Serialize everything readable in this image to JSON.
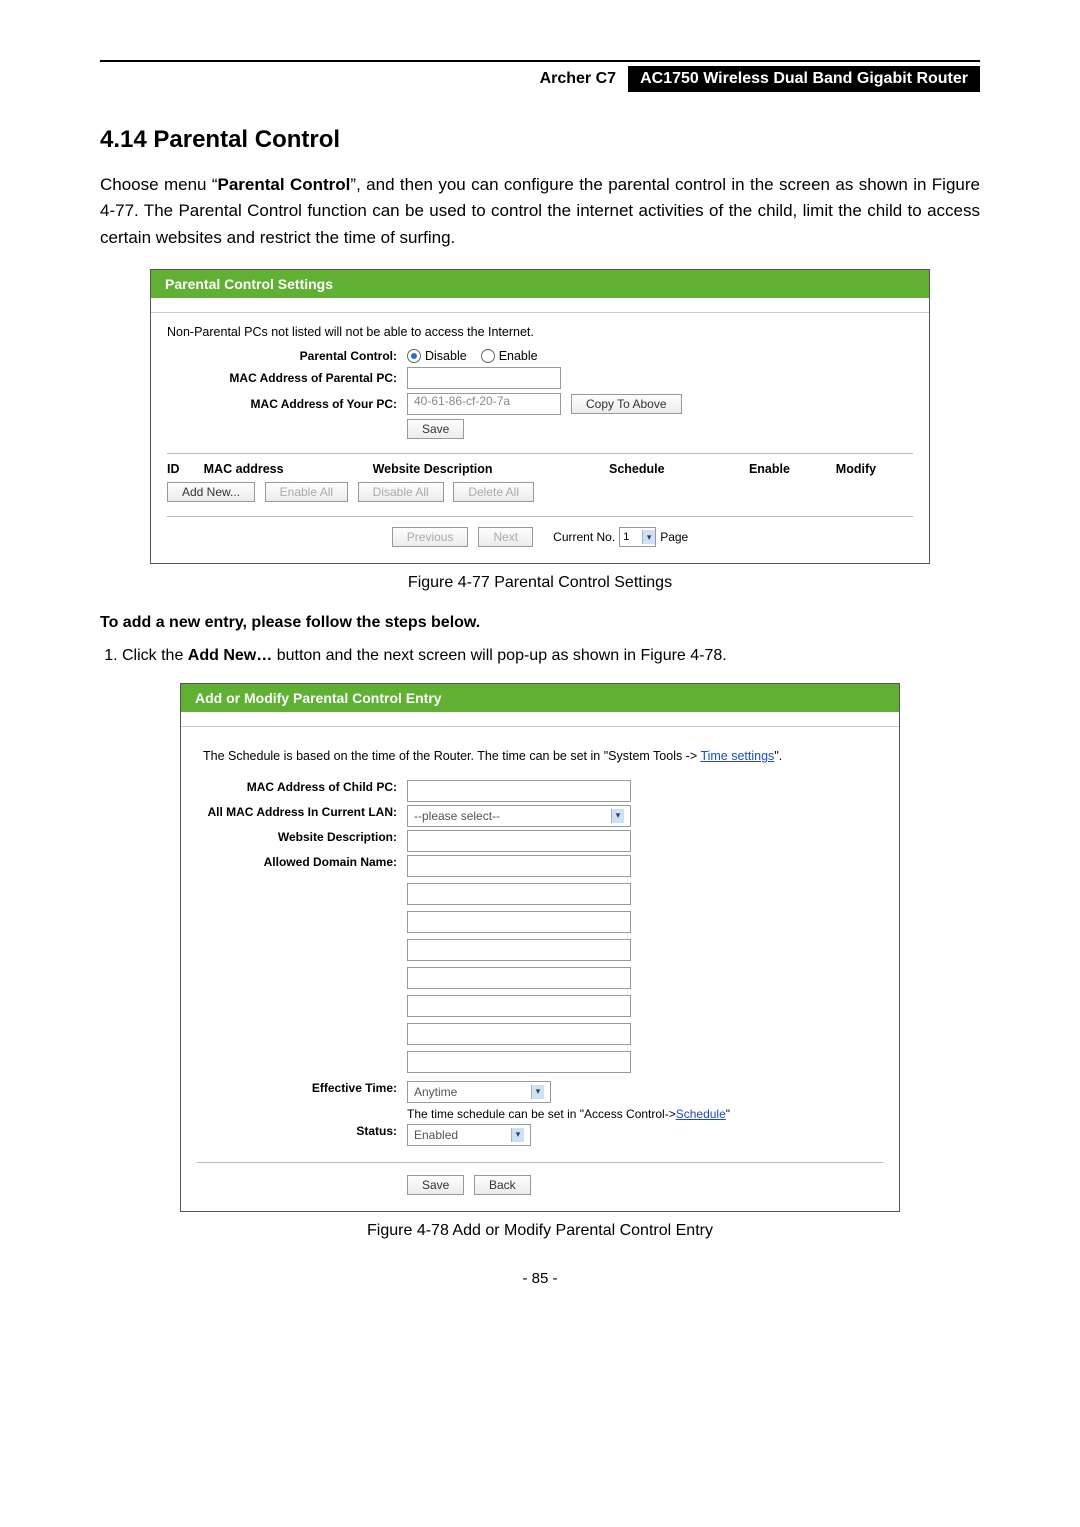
{
  "header": {
    "model": "Archer C7",
    "product": "AC1750 Wireless Dual Band Gigabit Router"
  },
  "section": {
    "number_title": "4.14  Parental Control",
    "intro_before_bold": "Choose menu “",
    "intro_bold": "Parental Control",
    "intro_after_bold": "”, and then you can configure the parental control in the screen as shown in Figure 4-77. The Parental Control function can be used to control the internet activities of the child, limit the child to access certain websites and restrict the time of surfing."
  },
  "shot1": {
    "title": "Parental Control Settings",
    "note": "Non-Parental PCs not listed will not be able to access the Internet.",
    "labels": {
      "pc": "Parental Control:",
      "mac_parent": "MAC Address of Parental PC:",
      "mac_your": "MAC Address of Your PC:"
    },
    "radio": {
      "disable": "Disable",
      "enable": "Enable"
    },
    "mac_value": "40-61-86-cf-20-7a",
    "btn_copy": "Copy To Above",
    "btn_save": "Save",
    "table": {
      "id": "ID",
      "mac": "MAC address",
      "desc": "Website Description",
      "sched": "Schedule",
      "enable": "Enable",
      "modify": "Modify"
    },
    "btns": {
      "add": "Add New...",
      "enable_all": "Enable All",
      "disable_all": "Disable All",
      "delete_all": "Delete All"
    },
    "pager": {
      "prev": "Previous",
      "next": "Next",
      "current": "Current No.",
      "page_num": "1",
      "page": "Page"
    }
  },
  "caption1": "Figure 4-77 Parental Control Settings",
  "subhead": "To add a new entry, please follow the steps below.",
  "step1_before": "Click the ",
  "step1_bold": "Add New…",
  "step1_after": " button and the next screen will pop-up as shown in Figure 4-78.",
  "shot2": {
    "title": "Add or Modify Parental Control Entry",
    "note_before": "The Schedule is based on the time of the Router. The time can be set in \"System Tools -> ",
    "note_link": "Time settings",
    "note_after": "\".",
    "labels": {
      "mac_child": "MAC Address of Child PC:",
      "all_mac": "All MAC Address In Current LAN:",
      "desc": "Website Description:",
      "domain": "Allowed Domain Name:",
      "eff_time": "Effective Time:",
      "status": "Status:"
    },
    "select_placeholder": "--please select--",
    "eff_time_value": "Anytime",
    "help_before": "The time schedule can be set in \"Access Control->",
    "help_link": "Schedule",
    "help_after": "\"",
    "status_value": "Enabled",
    "btn_save": "Save",
    "btn_back": "Back"
  },
  "caption2": "Figure 4-78 Add or Modify Parental Control Entry",
  "page_number": "- 85 -"
}
